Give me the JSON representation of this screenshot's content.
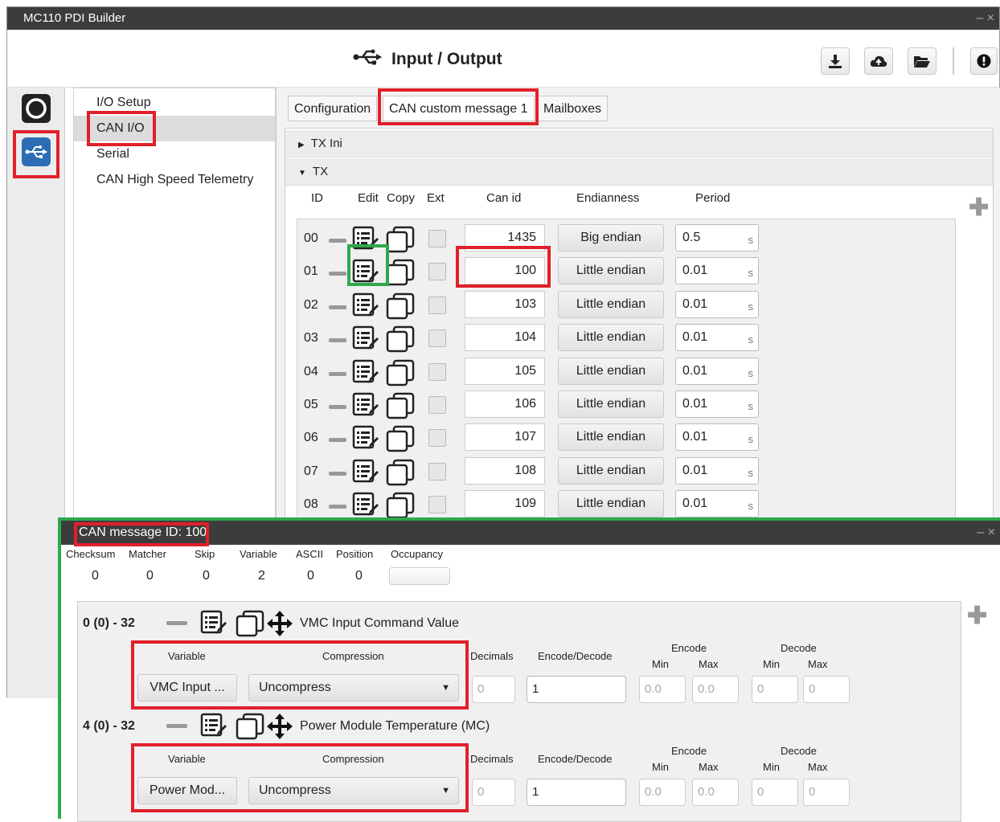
{
  "window": {
    "title": "MC110 PDI Builder",
    "controls": "– ×"
  },
  "header": {
    "title": "Input / Output",
    "title_icon": "usb-icon",
    "buttons": [
      "download-icon",
      "cloud-upload-icon",
      "folder-open-icon",
      "info-icon"
    ]
  },
  "sidebar": {
    "icons": [
      "power-icon",
      "usb-icon"
    ]
  },
  "nav": {
    "items": [
      {
        "label": "I/O Setup"
      },
      {
        "label": "CAN I/O"
      },
      {
        "label": "Serial"
      },
      {
        "label": "CAN High Speed Telemetry"
      }
    ]
  },
  "tabs": [
    {
      "label": "Configuration"
    },
    {
      "label": "CAN custom message 1"
    },
    {
      "label": "Mailboxes"
    }
  ],
  "sections": {
    "tx_ini": "TX Ini",
    "tx": "TX"
  },
  "columns": {
    "id": "ID",
    "edit": "Edit",
    "copy": "Copy",
    "ext": "Ext",
    "can_id": "Can id",
    "endianness": "Endianness",
    "period": "Period"
  },
  "rows": [
    {
      "id": "00",
      "can_id": "1435",
      "endianness": "Big endian",
      "period": "0.5",
      "unit": "s"
    },
    {
      "id": "01",
      "can_id": "100",
      "endianness": "Little endian",
      "period": "0.01",
      "unit": "s"
    },
    {
      "id": "02",
      "can_id": "103",
      "endianness": "Little endian",
      "period": "0.01",
      "unit": "s"
    },
    {
      "id": "03",
      "can_id": "104",
      "endianness": "Little endian",
      "period": "0.01",
      "unit": "s"
    },
    {
      "id": "04",
      "can_id": "105",
      "endianness": "Little endian",
      "period": "0.01",
      "unit": "s"
    },
    {
      "id": "05",
      "can_id": "106",
      "endianness": "Little endian",
      "period": "0.01",
      "unit": "s"
    },
    {
      "id": "06",
      "can_id": "107",
      "endianness": "Little endian",
      "period": "0.01",
      "unit": "s"
    },
    {
      "id": "07",
      "can_id": "108",
      "endianness": "Little endian",
      "period": "0.01",
      "unit": "s"
    },
    {
      "id": "08",
      "can_id": "109",
      "endianness": "Little endian",
      "period": "0.01",
      "unit": "s"
    }
  ],
  "popup": {
    "title": "CAN message ID: 100",
    "controls": "– ×",
    "stats": [
      {
        "label": "Checksum",
        "value": "0"
      },
      {
        "label": "Matcher",
        "value": "0"
      },
      {
        "label": "Skip",
        "value": "0"
      },
      {
        "label": "Variable",
        "value": "2"
      },
      {
        "label": "ASCII",
        "value": "0"
      },
      {
        "label": "Position",
        "value": "0"
      },
      {
        "label": "Occupancy",
        "value": ""
      }
    ],
    "fields": [
      {
        "range": "0 (0) - 32",
        "name": "VMC Input Command Value",
        "variable_label": "Variable",
        "compression_label": "Compression",
        "variable": "VMC Input ...",
        "compression": "Uncompress",
        "decimals_label": "Decimals",
        "decimals": "0",
        "encdec_label": "Encode/Decode",
        "encdec": "1",
        "encode_label": "Encode",
        "decode_label": "Decode",
        "min_label": "Min",
        "max_label": "Max",
        "enc_min": "0.0",
        "enc_max": "0.0",
        "dec_min": "0",
        "dec_max": "0"
      },
      {
        "range": "4 (0) - 32",
        "name": "Power Module Temperature (MC)",
        "variable_label": "Variable",
        "compression_label": "Compression",
        "variable": "Power Mod...",
        "compression": "Uncompress",
        "decimals_label": "Decimals",
        "decimals": "0",
        "encdec_label": "Encode/Decode",
        "encdec": "1",
        "encode_label": "Encode",
        "decode_label": "Decode",
        "min_label": "Min",
        "max_label": "Max",
        "enc_min": "0.0",
        "enc_max": "0.0",
        "dec_min": "0",
        "dec_max": "0"
      }
    ]
  },
  "colors": {
    "highlight_red": "#e0202a",
    "highlight_green": "#2fa84a",
    "titlebar": "#3c3c3c",
    "accent_blue": "#2d6db5"
  }
}
